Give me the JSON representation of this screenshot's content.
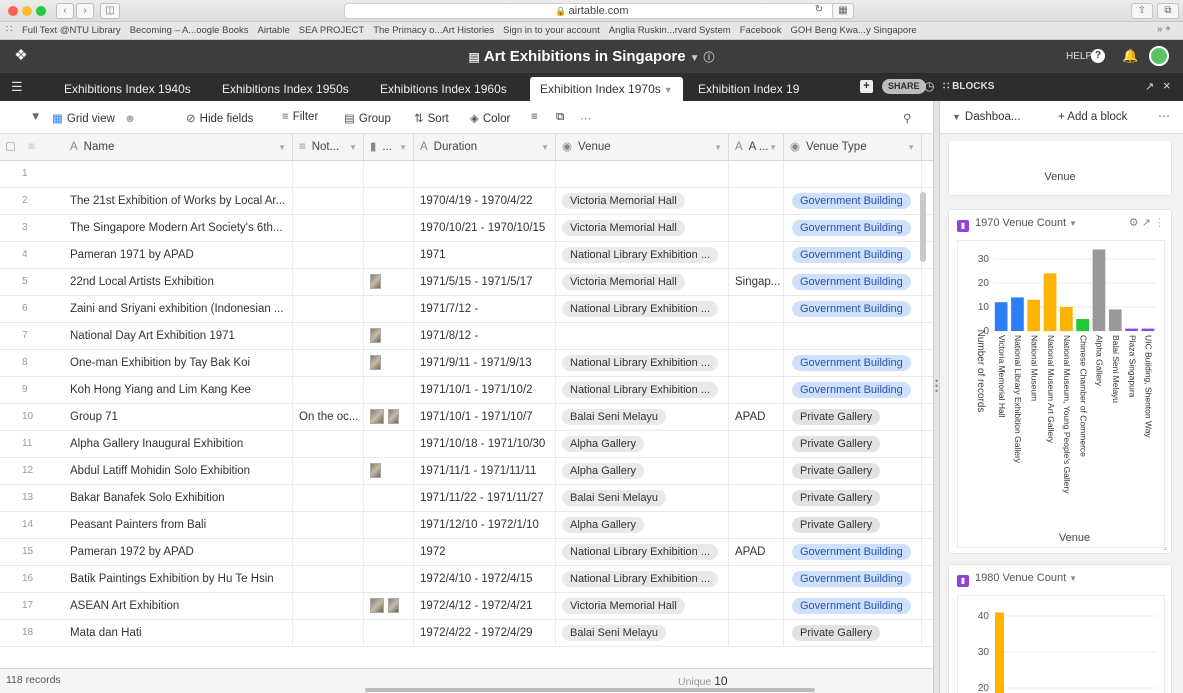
{
  "browser": {
    "url": "airtable.com",
    "bookmarks": [
      "Full Text @NTU Library",
      "Becoming – A...oogle Books",
      "Airtable",
      "SEA PROJECT",
      "The Primacy o...Art Histories",
      "Sign in to your account",
      "Anglia Ruskin...rvard System",
      "Facebook",
      "GOH Beng Kwa...y Singapore"
    ]
  },
  "app": {
    "base_title": "Art Exhibitions in Singapore",
    "help_label": "HELP",
    "share_label": "SHARE",
    "blocks_label": "BLOCKS"
  },
  "tabs": [
    {
      "label": "Exhibitions Index 1940s",
      "active": false
    },
    {
      "label": "Exhibitions Index 1950s",
      "active": false
    },
    {
      "label": "Exhibitions Index 1960s",
      "active": false
    },
    {
      "label": "Exhibition Index 1970s",
      "active": true
    },
    {
      "label": "Exhibition Index 19",
      "active": false
    }
  ],
  "viewbar": {
    "view_name": "Grid view",
    "hide_fields": "Hide fields",
    "filter": "Filter",
    "group": "Group",
    "sort": "Sort",
    "color": "Color"
  },
  "columns": {
    "name": "Name",
    "notes": "Not...",
    "attachment": "...",
    "duration": "Duration",
    "venue": "Venue",
    "address": "A ...",
    "venue_type": "Venue Type"
  },
  "rows": [
    {
      "n": "1",
      "name": "",
      "notes": "",
      "thumbs": 0,
      "duration": "",
      "venue": "",
      "addr": "",
      "type": ""
    },
    {
      "n": "2",
      "name": "The 21st Exhibition of Works by Local Ar...",
      "notes": "",
      "thumbs": 0,
      "duration": "1970/4/19 - 1970/4/22",
      "venue": "Victoria Memorial Hall",
      "addr": "",
      "type": "Government Building"
    },
    {
      "n": "3",
      "name": "The Singapore Modern Art Society's 6th...",
      "notes": "",
      "thumbs": 0,
      "duration": "1970/10/21 - 1970/10/15",
      "venue": "Victoria Memorial Hall",
      "addr": "",
      "type": "Government Building"
    },
    {
      "n": "4",
      "name": "Pameran 1971 by APAD",
      "notes": "",
      "thumbs": 0,
      "duration": "1971",
      "venue": "National Library Exhibition ...",
      "addr": "",
      "type": "Government Building"
    },
    {
      "n": "5",
      "name": "22nd Local Artists Exhibition",
      "notes": "",
      "thumbs": 1,
      "duration": "1971/5/15 - 1971/5/17",
      "venue": "Victoria Memorial Hall",
      "addr": "Singap...",
      "type": "Government Building"
    },
    {
      "n": "6",
      "name": "Zaini and Sriyani exhibition (Indonesian ...",
      "notes": "",
      "thumbs": 0,
      "duration": "1971/7/12 -",
      "venue": "National Library Exhibition ...",
      "addr": "",
      "type": "Government Building"
    },
    {
      "n": "7",
      "name": "National Day Art Exhibition 1971",
      "notes": "",
      "thumbs": 1,
      "duration": "1971/8/12 -",
      "venue": "",
      "addr": "",
      "type": ""
    },
    {
      "n": "8",
      "name": "One-man Exhibition by Tay Bak Koi",
      "notes": "",
      "thumbs": 1,
      "duration": "1971/9/11 - 1971/9/13",
      "venue": "National Library Exhibition ...",
      "addr": "",
      "type": "Government Building"
    },
    {
      "n": "9",
      "name": "Koh Hong Yiang and Lim Kang Kee",
      "notes": "",
      "thumbs": 0,
      "duration": "1971/10/1 - 1971/10/2",
      "venue": "National Library Exhibition ...",
      "addr": "",
      "type": "Government Building"
    },
    {
      "n": "10",
      "name": "Group 71",
      "notes": "On the oc...",
      "thumbs": 2,
      "duration": "1971/10/1 - 1971/10/7",
      "venue": "Balai Seni Melayu",
      "addr": "APAD",
      "type": "Private Gallery"
    },
    {
      "n": "11",
      "name": "Alpha Gallery Inaugural Exhibition",
      "notes": "",
      "thumbs": 0,
      "duration": "1971/10/18 - 1971/10/30",
      "venue": "Alpha Gallery",
      "addr": "",
      "type": "Private Gallery"
    },
    {
      "n": "12",
      "name": "Abdul Latiff Mohidin Solo Exhibition",
      "notes": "",
      "thumbs": 1,
      "duration": "1971/11/1 - 1971/11/11",
      "venue": "Alpha Gallery",
      "addr": "",
      "type": "Private Gallery"
    },
    {
      "n": "13",
      "name": "Bakar Banafek Solo Exhibition",
      "notes": "",
      "thumbs": 0,
      "duration": "1971/11/22 - 1971/11/27",
      "venue": "Balai Seni Melayu",
      "addr": "",
      "type": "Private Gallery"
    },
    {
      "n": "14",
      "name": "Peasant Painters from Bali",
      "notes": "",
      "thumbs": 0,
      "duration": "1971/12/10 - 1972/1/10",
      "venue": "Alpha Gallery",
      "addr": "",
      "type": "Private Gallery"
    },
    {
      "n": "15",
      "name": "Pameran 1972 by APAD",
      "notes": "",
      "thumbs": 0,
      "duration": "1972",
      "venue": "National Library Exhibition ...",
      "addr": "APAD",
      "type": "Government Building"
    },
    {
      "n": "16",
      "name": "Batik Paintings Exhibition by Hu Te Hsin",
      "notes": "",
      "thumbs": 0,
      "duration": "1972/4/10 - 1972/4/15",
      "venue": "National Library Exhibition ...",
      "addr": "",
      "type": "Government Building"
    },
    {
      "n": "17",
      "name": "ASEAN Art Exhibition",
      "notes": "",
      "thumbs": 2,
      "duration": "1972/4/12 - 1972/4/21",
      "venue": "Victoria Memorial Hall",
      "addr": "",
      "type": "Government Building"
    },
    {
      "n": "18",
      "name": "Mata dan Hati",
      "notes": "",
      "thumbs": 0,
      "duration": "1972/4/22 - 1972/4/29",
      "venue": "Balai Seni Melayu",
      "addr": "",
      "type": "Private Gallery"
    }
  ],
  "footer": {
    "records": "118 records",
    "unique_label": "Unique",
    "unique_value": "10"
  },
  "panel": {
    "dashboard": "Dashboa...",
    "add_block": "+ Add a block",
    "prev_chart_xlabel": "Venue"
  },
  "chart_data": [
    {
      "type": "bar",
      "title": "1970 Venue Count",
      "xlabel": "Venue",
      "ylabel": "Number of records",
      "ylim": [
        0,
        35
      ],
      "yticks": [
        0,
        10,
        20,
        30
      ],
      "categories": [
        "Victoria Memorial Hall",
        "National Library Exhibition Gallery",
        "National Museum",
        "National Museum Art Gallery",
        "National Museum, Young People's Gallery",
        "Chinese Chamber of Commerce",
        "Alpha Gallery",
        "Balai Seni Melayu",
        "Plaza Singapura",
        "UIC Building, Shenton Way"
      ],
      "values": [
        12,
        14,
        13,
        24,
        10,
        5,
        34,
        9,
        1,
        1
      ],
      "colors": [
        "#2d7ff9",
        "#2d7ff9",
        "#fcb400",
        "#fcb400",
        "#fcb400",
        "#20c933",
        "#999999",
        "#999999",
        "#8b46ff",
        "#8b46ff"
      ]
    },
    {
      "type": "bar",
      "title": "1980 Venue Count",
      "ylim": [
        15,
        45
      ],
      "yticks": [
        20,
        30,
        40
      ],
      "categories": [
        ""
      ],
      "values": [
        41
      ],
      "colors": [
        "#fcb400"
      ]
    }
  ]
}
